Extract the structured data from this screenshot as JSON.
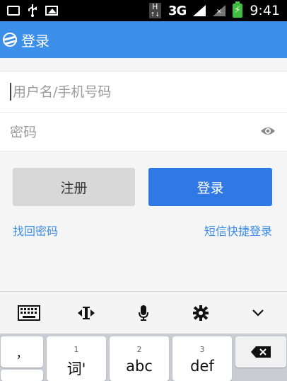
{
  "status_bar": {
    "network": "3G",
    "h_badge": "H",
    "time": "9:41",
    "icons": [
      "usb-icon",
      "image-icon",
      "signal-icon",
      "battery-icon"
    ]
  },
  "app_bar": {
    "title": "登录",
    "accent": "#3b8fe8"
  },
  "form": {
    "username_placeholder": "用户名/手机号码",
    "password_placeholder": "密码",
    "username_value": "",
    "password_value": ""
  },
  "buttons": {
    "register": "注册",
    "login": "登录",
    "login_color": "#2f78e6"
  },
  "links": {
    "forgot_password": "找回密码",
    "sms_login": "短信快捷登录"
  },
  "keyboard": {
    "toolbar_icons": [
      "keyboard-icon",
      "cursor-move-icon",
      "microphone-icon",
      "settings-icon",
      "collapse-icon"
    ],
    "keys": [
      {
        "num": "",
        "label": "，"
      },
      {
        "num": "1",
        "label": "词'"
      },
      {
        "num": "2",
        "label": "abc"
      },
      {
        "num": "3",
        "label": "def"
      }
    ]
  }
}
